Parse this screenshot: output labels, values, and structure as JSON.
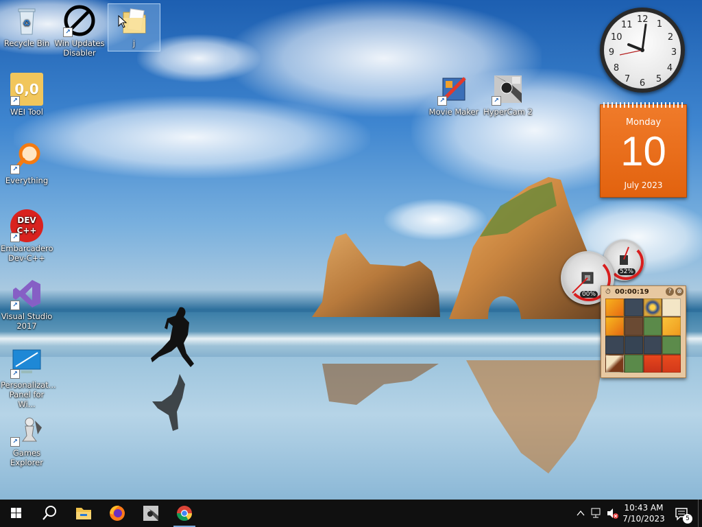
{
  "desktop": {
    "icons": [
      {
        "label": "Recycle Bin"
      },
      {
        "label": "Win Updates Disabler"
      },
      {
        "label": "j"
      },
      {
        "label": "WEI Tool"
      },
      {
        "label": "Everything"
      },
      {
        "label": "Embarcadero Dev-C++"
      },
      {
        "label": "Visual Studio 2017"
      },
      {
        "label": "Personalizat... Panel for Wi..."
      },
      {
        "label": "Games Explorer"
      },
      {
        "label": "Movie Maker"
      },
      {
        "label": "HyperCam 2"
      }
    ],
    "wei_glyph_text": "0,0",
    "devcpp_glyph_text": "DEV C++"
  },
  "gadgets": {
    "clock": {
      "numbers": [
        "12",
        "1",
        "2",
        "3",
        "4",
        "5",
        "6",
        "7",
        "8",
        "9",
        "10",
        "11"
      ]
    },
    "calendar": {
      "day": "Monday",
      "date": "10",
      "month_year": "July 2023"
    },
    "cpu_meter": {
      "value": "00%"
    },
    "ram_meter": {
      "value": "52%"
    },
    "puzzle": {
      "timer": "00:00:19",
      "help": "?",
      "close": "⊗"
    }
  },
  "taskbar": {
    "time": "10:43 AM",
    "date": "7/10/2023",
    "notification_count": "5",
    "pinned": [
      "start",
      "search",
      "file-explorer",
      "firefox",
      "hypercam",
      "chrome"
    ]
  },
  "colors": {
    "taskbar": "#101010",
    "calendar": "#e8680f",
    "accent": "#7aa7d8"
  }
}
